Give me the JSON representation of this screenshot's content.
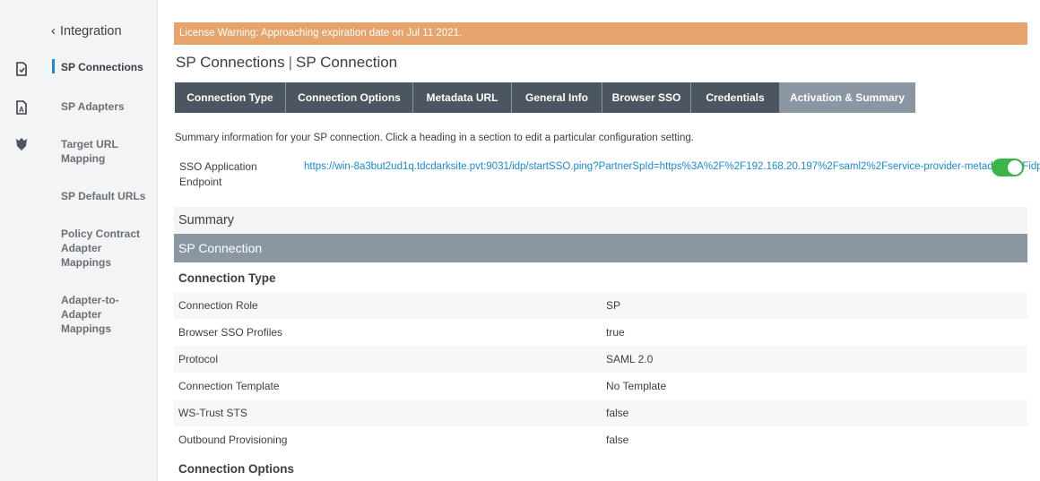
{
  "colors": {
    "accent": "#1a8bd1",
    "banner": "#e6a46c",
    "tab_bg": "#4c5660",
    "tab_active": "#8a96a1",
    "toggle_on": "#3bb44a"
  },
  "rail": {
    "icons": [
      "document-icon",
      "file-a-icon",
      "shield-group-icon"
    ]
  },
  "subnav": {
    "back_label": "Integration",
    "items": [
      {
        "label": "SP Connections",
        "active": true
      },
      {
        "label": "SP Adapters"
      },
      {
        "label": "Target URL Mapping"
      },
      {
        "label": "SP Default URLs"
      },
      {
        "label": "Policy Contract Adapter Mappings"
      },
      {
        "label": "Adapter-to-Adapter Mappings"
      }
    ]
  },
  "banner": {
    "text": "License Warning: Approaching expiration date on Jul 11 2021."
  },
  "page": {
    "title_part1": "SP Connections",
    "separator": "|",
    "title_part2": "SP Connection"
  },
  "tabs": [
    {
      "label": "Connection Type"
    },
    {
      "label": "Connection Options"
    },
    {
      "label": "Metadata URL"
    },
    {
      "label": "General Info"
    },
    {
      "label": "Browser SSO"
    },
    {
      "label": "Credentials"
    },
    {
      "label": "Activation & Summary",
      "active": true
    }
  ],
  "intro": "Summary information for your SP connection. Click a heading in a section to edit a particular configuration setting.",
  "endpoint": {
    "label": "SSO Application Endpoint",
    "url": "https://win-8a3but2ud1q.tdcdarksite.pvt:9031/idp/startSSO.ping?PartnerSpId=https%3A%2F%2F192.168.20.197%2Fsaml2%2Fservice-provider-metadata%2Fidp",
    "enabled": true
  },
  "summary": {
    "heading": "Summary",
    "section_title": "SP Connection",
    "connection_type_heading": "Connection Type",
    "rows": [
      {
        "key": "Connection Role",
        "value": "SP"
      },
      {
        "key": "Browser SSO Profiles",
        "value": "true"
      },
      {
        "key": "Protocol",
        "value": "SAML 2.0"
      },
      {
        "key": "Connection Template",
        "value": "No Template"
      },
      {
        "key": "WS-Trust STS",
        "value": "false"
      },
      {
        "key": "Outbound Provisioning",
        "value": "false"
      }
    ],
    "connection_options_heading": "Connection Options"
  }
}
